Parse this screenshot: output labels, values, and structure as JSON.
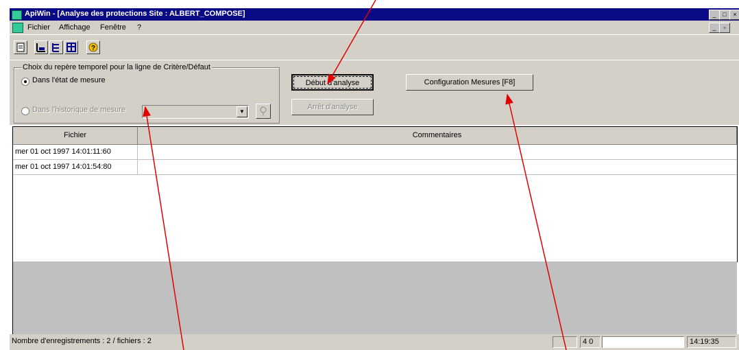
{
  "window": {
    "title": "ApiWin  - [Analyse des protections Site : ALBERT_COMPOSE]",
    "controls": [
      "_",
      "□",
      "×"
    ]
  },
  "menu": {
    "items": [
      "Fichier",
      "Affichage",
      "Fenêtre",
      "?"
    ]
  },
  "toolbar": {
    "icons": [
      "document-icon",
      "chart-icon",
      "tree-icon",
      "table-icon",
      "help-icon"
    ]
  },
  "selection": {
    "group_title": "Choix du repère temporel pour la ligne de Critère/Défaut",
    "radio_current": "Dans l'état de mesure",
    "radio_history": "Dans l'historique de mesure",
    "combo_value": ""
  },
  "buttons": {
    "start_analysis": "Début d'analyse",
    "stop_analysis": "Arrêt d'analyse",
    "config": "Configuration Mesures [F8]"
  },
  "table": {
    "columns": [
      "Fichier",
      "Commentaires"
    ],
    "rows": [
      {
        "file": "mer 01 oct 1997 14:01:11:60",
        "comment": ""
      },
      {
        "file": "mer 01 oct 1997 14:01:54:80",
        "comment": ""
      }
    ]
  },
  "status": {
    "left": "Nombre d'enregistrements : 2 / fichiers : 2",
    "indicator": "4 0",
    "time": "14:19:35"
  },
  "colors": {
    "titlebar": "#0a0a86",
    "face": "#d4d0c8",
    "annotation_arrow": "#e00000"
  }
}
